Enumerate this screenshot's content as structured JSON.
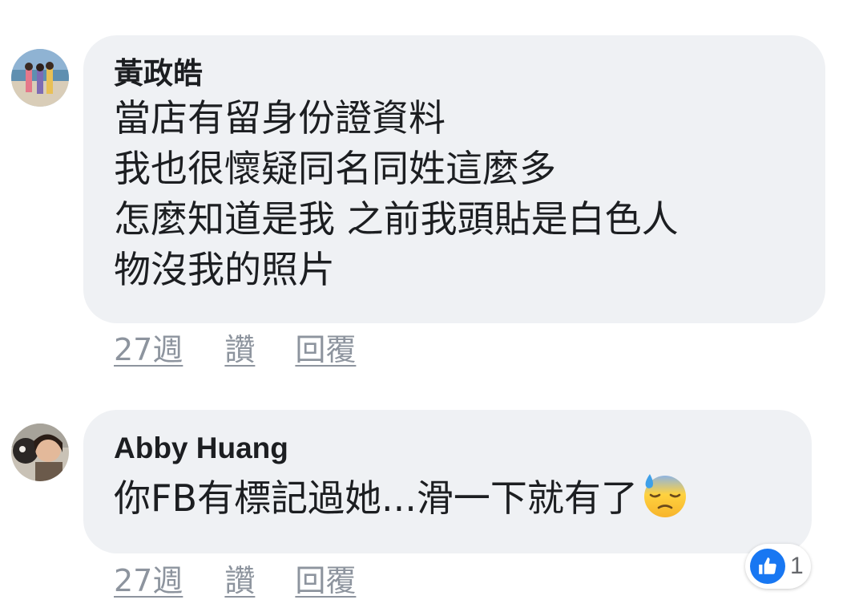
{
  "comments": [
    {
      "author": "黃政皓",
      "lines": [
        "當店有留身份證資料",
        "我也很懷疑同名同姓這麼多",
        "怎麼知道是我 之前我頭貼是白色人",
        "物沒我的照片"
      ],
      "timestamp": "27週",
      "like_label": "讚",
      "reply_label": "回覆"
    },
    {
      "author": "Abby Huang",
      "lines": [
        "你FB有標記過她...滑一下就有了"
      ],
      "emoji": "sweat-face-emoji",
      "timestamp": "27週",
      "like_label": "讚",
      "reply_label": "回覆",
      "reactions": {
        "icon": "like-icon",
        "count": "1"
      }
    }
  ],
  "colors": {
    "bubble": "#eff1f4",
    "text": "#1c1e21",
    "meta": "#8d949e",
    "like_blue": "#1877f2"
  }
}
